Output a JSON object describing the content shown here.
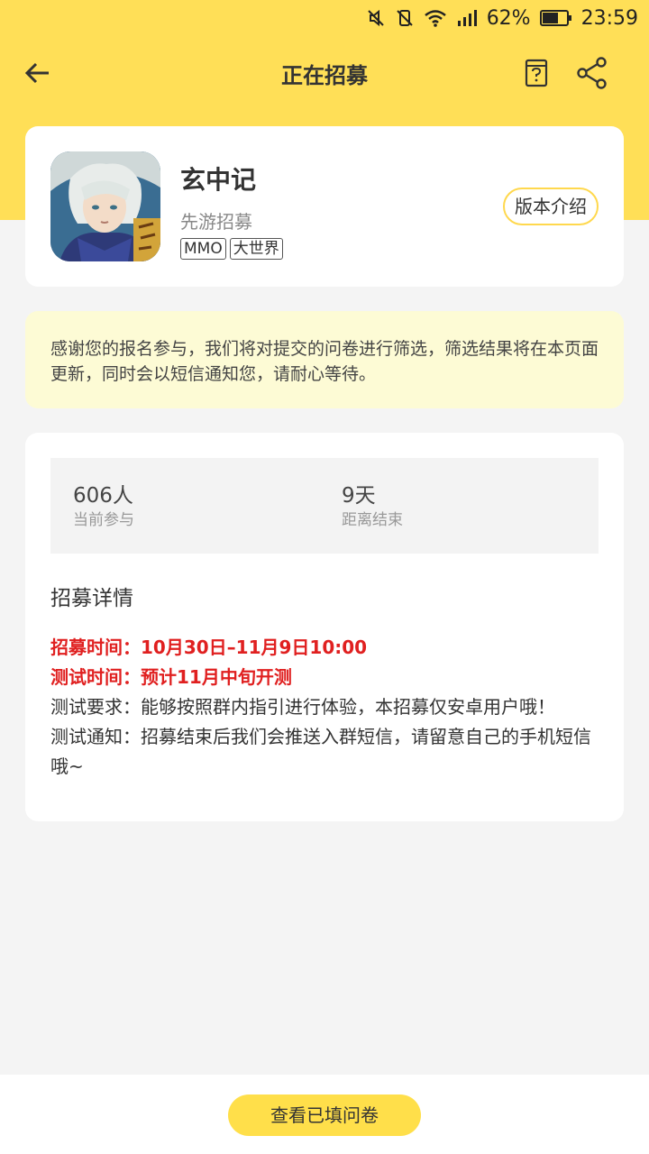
{
  "status_bar": {
    "battery_percent": "62%",
    "time": "23:59",
    "icons": [
      "mute-icon",
      "vibrate-off-icon",
      "wifi-icon",
      "signal-icon",
      "battery-icon"
    ]
  },
  "toolbar": {
    "title": "正在招募",
    "back_icon": "arrow-left-icon",
    "help_icon": "help-document-icon",
    "share_icon": "share-icon"
  },
  "game": {
    "name": "玄中记",
    "subtitle": "先游招募",
    "tags": [
      "MMO",
      "大世界"
    ],
    "version_button": "版本介绍"
  },
  "notice": {
    "text": "感谢您的报名参与，我们将对提交的问卷进行筛选，筛选结果将在本页面更新，同时会以短信通知您，请耐心等待。"
  },
  "stats": {
    "participants_value": "606人",
    "participants_label": "当前参与",
    "days_value": "9天",
    "days_label": "距离结束"
  },
  "details": {
    "title": "招募详情",
    "recruit_time": "招募时间：10月30日–11月9日10:00",
    "test_time": "测试时间：预计11月中旬开测",
    "test_requirement": "测试要求：能够按照群内指引进行体验，本招募仅安卓用户哦！",
    "test_notice": "测试通知：招募结束后我们会推送入群短信，请留意自己的手机短信哦~"
  },
  "bottom": {
    "view_button": "查看已填问卷"
  },
  "colors": {
    "accent_yellow": "#ffdf57",
    "notice_bg": "#fdfbd5",
    "highlight_red": "#e02020"
  }
}
